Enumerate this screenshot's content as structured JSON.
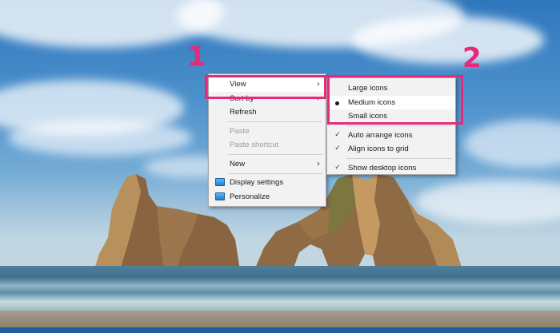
{
  "annotations": {
    "marker_1": "1",
    "marker_2": "2",
    "accent_color": "#e8297a"
  },
  "context_menu": {
    "view": "View",
    "sort_by": "Sort by",
    "refresh": "Refresh",
    "paste": "Paste",
    "paste_shortcut": "Paste shortcut",
    "new": "New",
    "display_settings": "Display settings",
    "personalize": "Personalize",
    "submenu_arrow": "›"
  },
  "view_submenu": {
    "large_icons": "Large icons",
    "medium_icons": "Medium icons",
    "small_icons": "Small icons",
    "auto_arrange": "Auto arrange icons",
    "align_to_grid": "Align icons to grid",
    "show_desktop_icons": "Show desktop icons",
    "selected_size": "Medium icons",
    "checked": [
      "Auto arrange icons",
      "Align icons to grid",
      "Show desktop icons"
    ],
    "check_glyph": "✓"
  },
  "icons": {
    "display_settings": "display-monitor-icon",
    "personalize": "personalize-monitor-icon"
  }
}
